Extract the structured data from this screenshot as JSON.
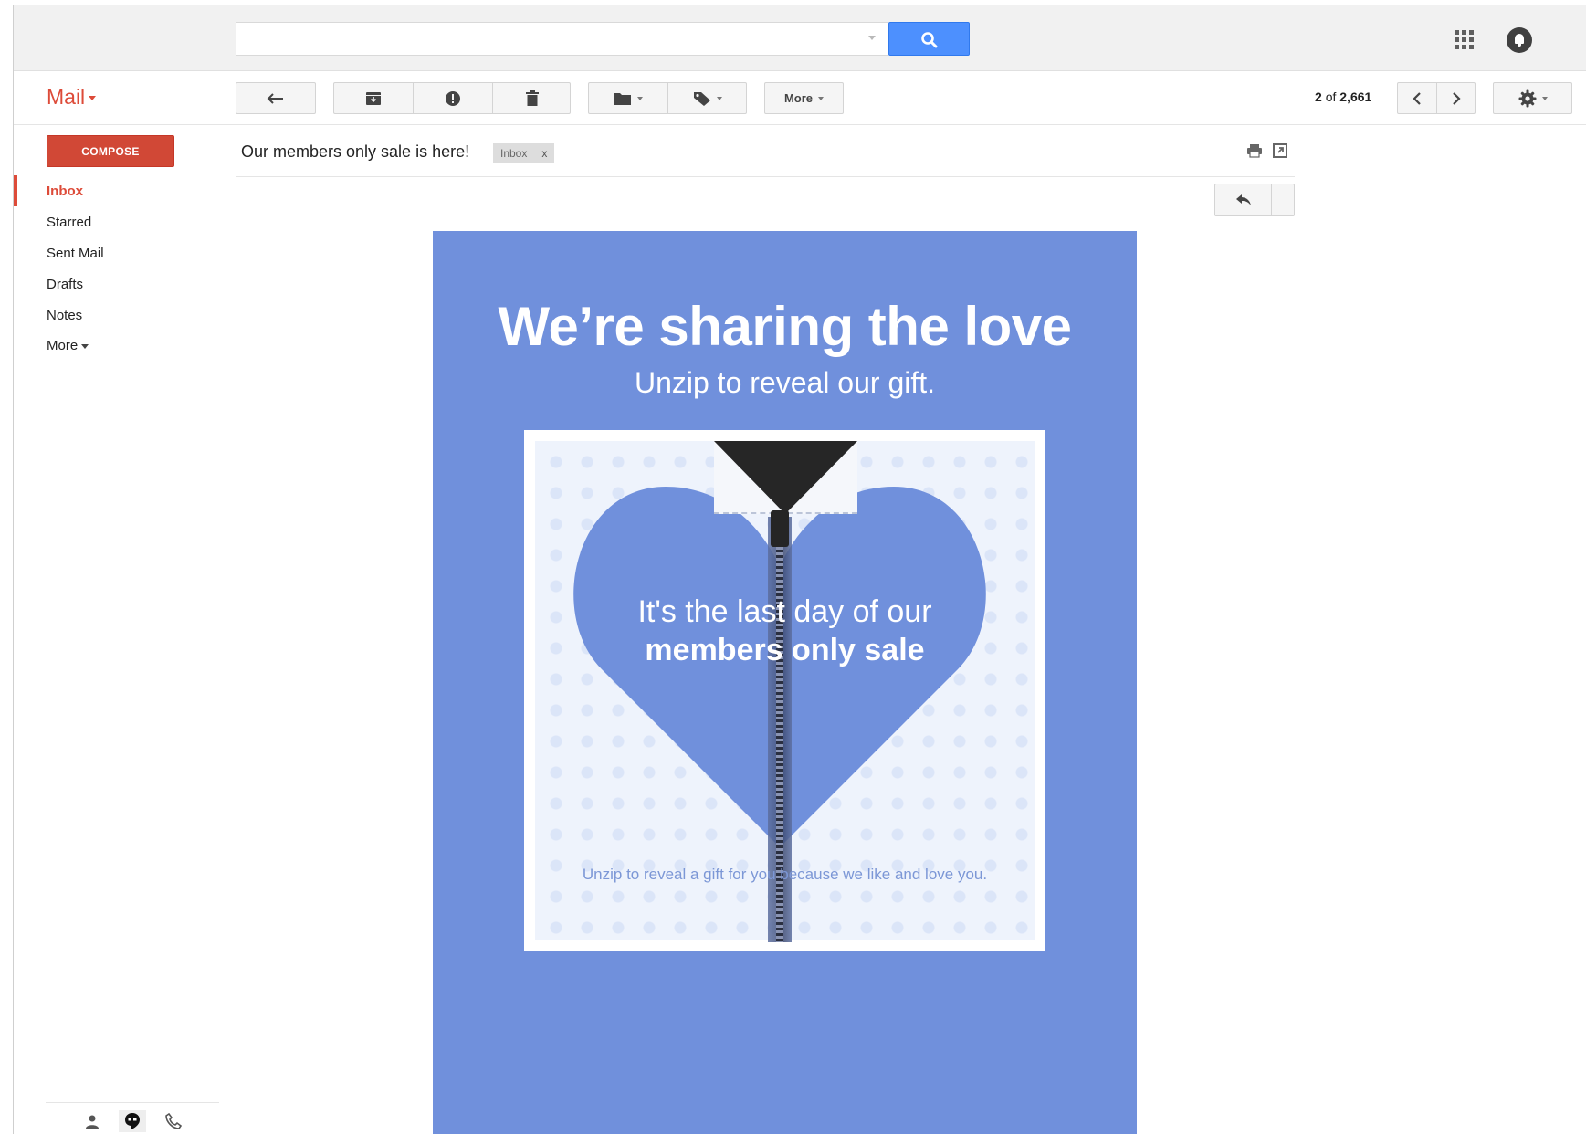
{
  "app": {
    "name": "Mail"
  },
  "search": {
    "value": "",
    "placeholder": ""
  },
  "toolbar": {
    "more_label": "More",
    "pager": {
      "position": "2",
      "of": "of",
      "total": "2,661"
    }
  },
  "sidebar": {
    "compose_label": "COMPOSE",
    "items": [
      {
        "label": "Inbox",
        "active": true
      },
      {
        "label": "Starred"
      },
      {
        "label": "Sent Mail"
      },
      {
        "label": "Drafts"
      },
      {
        "label": "Notes"
      },
      {
        "label": "More"
      }
    ]
  },
  "message": {
    "subject": "Our members only sale is here!",
    "label_chip": "Inbox",
    "label_remove": "x"
  },
  "email": {
    "headline": "We’re sharing the love",
    "subhead": "Unzip to reveal our gift.",
    "promo_line1": "It's the last day of our",
    "promo_line2": "members only sale",
    "caption": "Unzip to reveal a gift for you because we like and love you."
  },
  "colors": {
    "accent_red": "#dd4b39",
    "compose_red": "#d14836",
    "search_blue": "#4d90fe",
    "email_bg": "#7090dc"
  },
  "icons": {
    "search": "search-icon",
    "apps": "apps-grid-icon",
    "notifications": "notifications-icon",
    "back": "back-arrow-icon",
    "archive": "archive-icon",
    "spam": "report-spam-icon",
    "delete": "trash-icon",
    "move": "folder-icon",
    "labels": "label-tag-icon",
    "prev": "chevron-left-icon",
    "next": "chevron-right-icon",
    "settings": "gear-icon",
    "print": "print-icon",
    "new_window": "new-window-icon",
    "reply": "reply-icon",
    "reply_more": "chevron-down-icon",
    "contacts": "person-icon",
    "hangouts": "hangouts-icon",
    "phone": "phone-icon"
  }
}
